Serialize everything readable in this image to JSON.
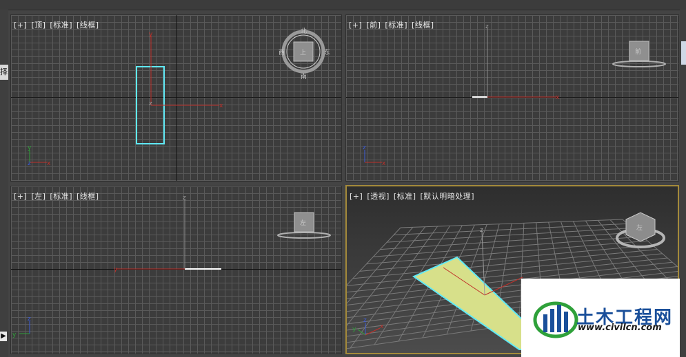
{
  "viewports": {
    "top": {
      "labels": [
        "[+]",
        "[顶]",
        "[标准]",
        "[线框]"
      ],
      "gizmo": {
        "center": "上",
        "north": "北",
        "south": "南",
        "east": "东",
        "west": "西"
      }
    },
    "front": {
      "labels": [
        "[+]",
        "[前]",
        "[标准]",
        "[线框]"
      ],
      "gizmo": {
        "center": "前"
      }
    },
    "left": {
      "labels": [
        "[+]",
        "[左]",
        "[标准]",
        "[线框]"
      ],
      "gizmo": {
        "center": "左"
      }
    },
    "perspective": {
      "labels": [
        "[+]",
        "[透视]",
        "[标准]",
        "[默认明暗处理]"
      ],
      "gizmo": {
        "center": "左"
      }
    }
  },
  "axes": {
    "x": "x",
    "y": "y",
    "z": "z"
  },
  "left_panel": {
    "tab_text": "择",
    "arrow": "▶"
  },
  "watermark": {
    "title": "土木工程网",
    "url": "www.civilcn.com"
  },
  "colors": {
    "selection": "#5fe9f5",
    "plane_fill": "#d7e08a",
    "axis_red": "#c0302a",
    "axis_green": "#2fa13a",
    "axis_blue": "#3b5bd6",
    "active_border": "#a48a3a"
  }
}
